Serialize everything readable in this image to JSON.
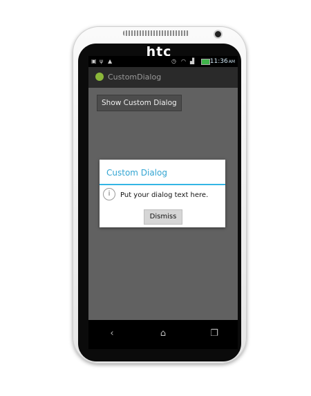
{
  "device": {
    "brand": "htc"
  },
  "status_bar": {
    "time": "11:36",
    "am_pm": "AM",
    "icons": [
      "chat-icon",
      "usb-icon",
      "android-debug-icon",
      "alarm-icon",
      "wifi-icon",
      "signal-icon",
      "battery-icon"
    ]
  },
  "action_bar": {
    "title": "CustomDialog",
    "icon": "android-app-icon"
  },
  "main": {
    "show_button_label": "Show Custom Dialog"
  },
  "dialog": {
    "title": "Custom Dialog",
    "text": "Put your dialog text here.",
    "icon": "info-icon",
    "dismiss_label": "Dismiss"
  },
  "nav_bar": {
    "items": [
      "back-icon",
      "home-icon",
      "recent-apps-icon"
    ]
  },
  "colors": {
    "dialog_accent": "#33b5e5",
    "screen_background": "#616161",
    "action_bar": "#2a2a2a"
  }
}
